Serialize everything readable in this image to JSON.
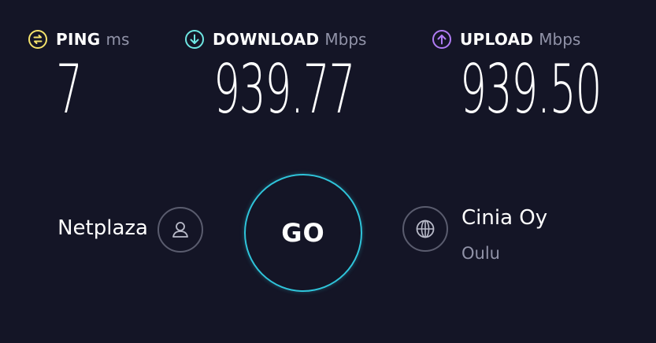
{
  "metrics": {
    "ping": {
      "label": "PING",
      "unit": "ms",
      "value": "7",
      "icon": "ping-icon",
      "color": "#f5e36b"
    },
    "download": {
      "label": "DOWNLOAD",
      "unit": "Mbps",
      "value": "939.77",
      "icon": "download-arrow-icon",
      "color": "#6ee6e2"
    },
    "upload": {
      "label": "UPLOAD",
      "unit": "Mbps",
      "value": "939.50",
      "icon": "upload-arrow-icon",
      "color": "#b07cf5"
    }
  },
  "go_button": {
    "label": "GO",
    "ring_color": "#2fc4da"
  },
  "isp": {
    "name": "Netplaza",
    "icon": "user-icon"
  },
  "server": {
    "name": "Cinia Oy",
    "location": "Oulu",
    "icon": "globe-icon"
  },
  "colors": {
    "background": "#141526",
    "muted_text": "#9193a8"
  }
}
